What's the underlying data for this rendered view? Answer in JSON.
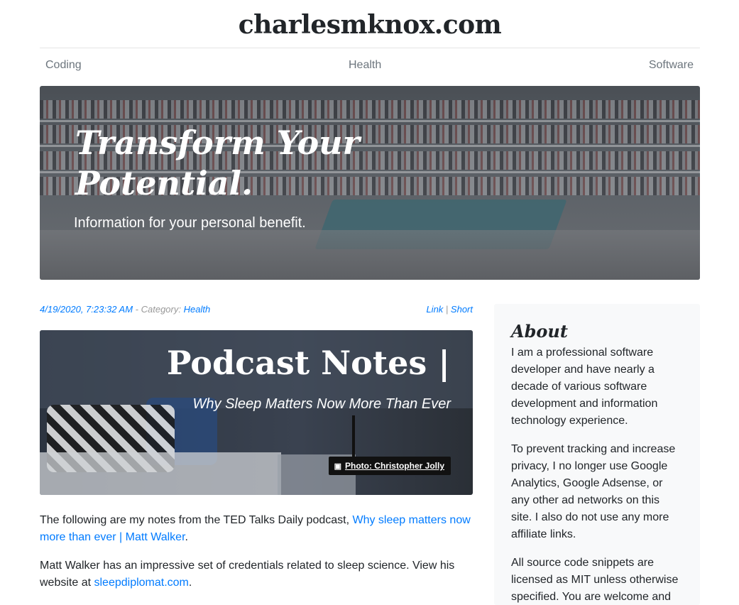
{
  "site": {
    "title": "charlesmknox.com"
  },
  "nav": {
    "items": [
      "Coding",
      "Health",
      "Software"
    ]
  },
  "hero": {
    "title": "Transform Your Potential.",
    "subtitle": "Information for your personal benefit."
  },
  "post": {
    "date": "4/19/2020, 7:23:32 AM",
    "category_prefix": " - Category: ",
    "category": "Health",
    "link_label": "Link",
    "separator": " | ",
    "short_label": "Short",
    "card_title": "Podcast Notes |",
    "card_subtitle": "Why Sleep Matters Now More Than Ever",
    "photo_credit": "Photo: Christopher Jolly",
    "p1_text": "The following are my notes from the TED Talks Daily podcast, ",
    "p1_link": "Why sleep matters now more than ever | Matt Walker",
    "p1_end": ".",
    "p2_text": "Matt Walker has an impressive set of credentials related to sleep science. View his website at ",
    "p2_link": "sleepdiplomat.com",
    "p2_end": "."
  },
  "sidebar": {
    "title": "About",
    "paragraphs": [
      "I am a professional software developer and have nearly a decade of various software development and information technology experience.",
      "To prevent tracking and increase privacy, I no longer use Google Analytics, Google Adsense, or any other ad networks on this site. I also do not use any more affiliate links.",
      "All source code snippets are licensed as MIT unless otherwise specified. You are welcome and encouraged to use them."
    ]
  },
  "colors": {
    "link": "#007bff",
    "muted": "#6c757d",
    "sidebar_bg": "#f8f9fa"
  }
}
